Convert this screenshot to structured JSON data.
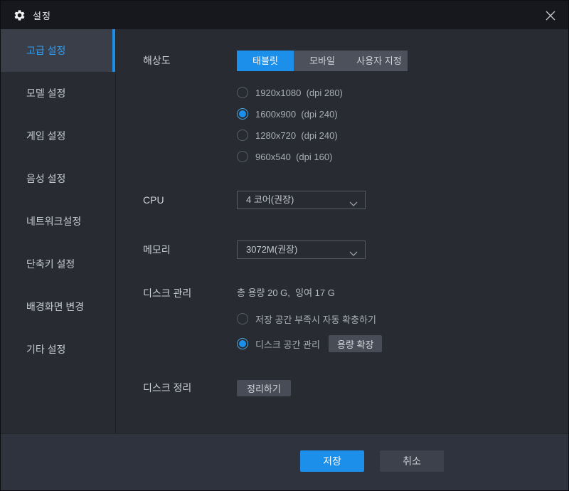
{
  "window": {
    "title": "설정"
  },
  "sidebar": {
    "items": [
      {
        "label": "고급 설정",
        "active": true
      },
      {
        "label": "모델 설정",
        "active": false
      },
      {
        "label": "게임 설정",
        "active": false
      },
      {
        "label": "음성 설정",
        "active": false
      },
      {
        "label": "네트워크설정",
        "active": false
      },
      {
        "label": "단축키 설정",
        "active": false
      },
      {
        "label": "배경화면 변경",
        "active": false
      },
      {
        "label": "기타 설정",
        "active": false
      }
    ]
  },
  "resolution": {
    "label": "해상도",
    "tabs": [
      {
        "label": "태블릿",
        "selected": true
      },
      {
        "label": "모바일",
        "selected": false
      },
      {
        "label": "사용자 지정",
        "selected": false
      }
    ],
    "options": [
      {
        "label": "1920x1080  (dpi 280)",
        "selected": false
      },
      {
        "label": "1600x900  (dpi 240)",
        "selected": true
      },
      {
        "label": "1280x720  (dpi 240)",
        "selected": false
      },
      {
        "label": "960x540  (dpi 160)",
        "selected": false
      }
    ]
  },
  "cpu": {
    "label": "CPU",
    "value": "4 코어(권장)"
  },
  "memory": {
    "label": "메모리",
    "value": "3072M(권장)"
  },
  "disk": {
    "label": "디스크 관리",
    "info": "총 용량 20 G,  잉여 17 G",
    "options": [
      {
        "label": "저장 공간 부족시 자동 확충하기",
        "selected": false
      },
      {
        "label": "디스크 공간 관리",
        "selected": true
      }
    ],
    "expand_button": "용량 확장"
  },
  "cleanup": {
    "label": "디스크 정리",
    "button": "정리하기"
  },
  "footer": {
    "save": "저장",
    "cancel": "취소"
  },
  "colors": {
    "accent": "#1b8fe9",
    "titlebar": "#16181d",
    "background": "#282b32",
    "footer": "#2f333d"
  }
}
